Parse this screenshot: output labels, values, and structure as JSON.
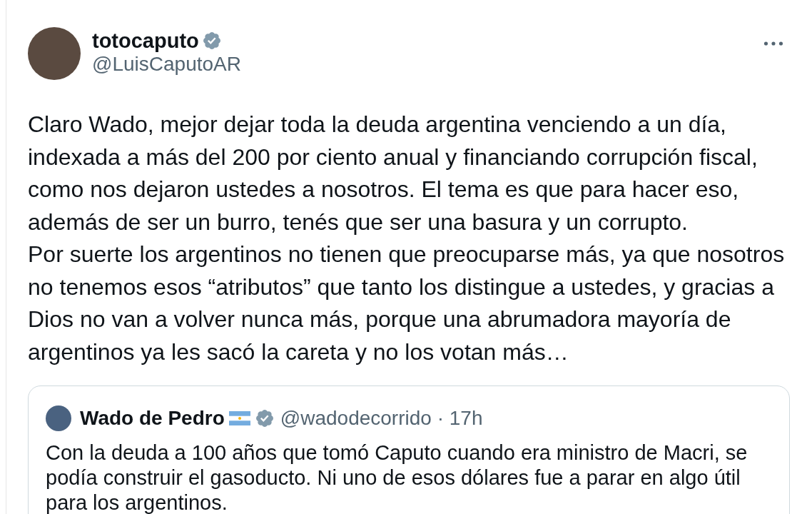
{
  "tweet": {
    "author": {
      "name": "totocaputo",
      "handle": "@LuisCaputoAR",
      "verified": true
    },
    "paragraphs": [
      "Claro Wado, mejor dejar toda la deuda argentina venciendo a un día, indexada a más del 200 por ciento anual y financiando corrupción fiscal, como nos dejaron ustedes a nosotros. El tema es que para hacer eso, además de ser un burro, tenés que ser una basura y un corrupto.",
      "Por suerte los argentinos no tienen que preocuparse más, ya que nosotros no tenemos esos “atributos” que tanto los distingue a ustedes, y gracias a Dios no van a volver nunca más, porque una abrumadora mayoría de argentinos ya les sacó la careta y no los votan más…"
    ],
    "quote": {
      "name": "Wado de Pedro",
      "verified": true,
      "meta": "@wadodecorrido · 17h",
      "text": "Con la deuda a 100 años que tomó Caputo cuando era ministro de Macri, se podía construir el gasoducto. Ni uno de esos dólares fue a parar en algo útil para los argentinos."
    }
  }
}
